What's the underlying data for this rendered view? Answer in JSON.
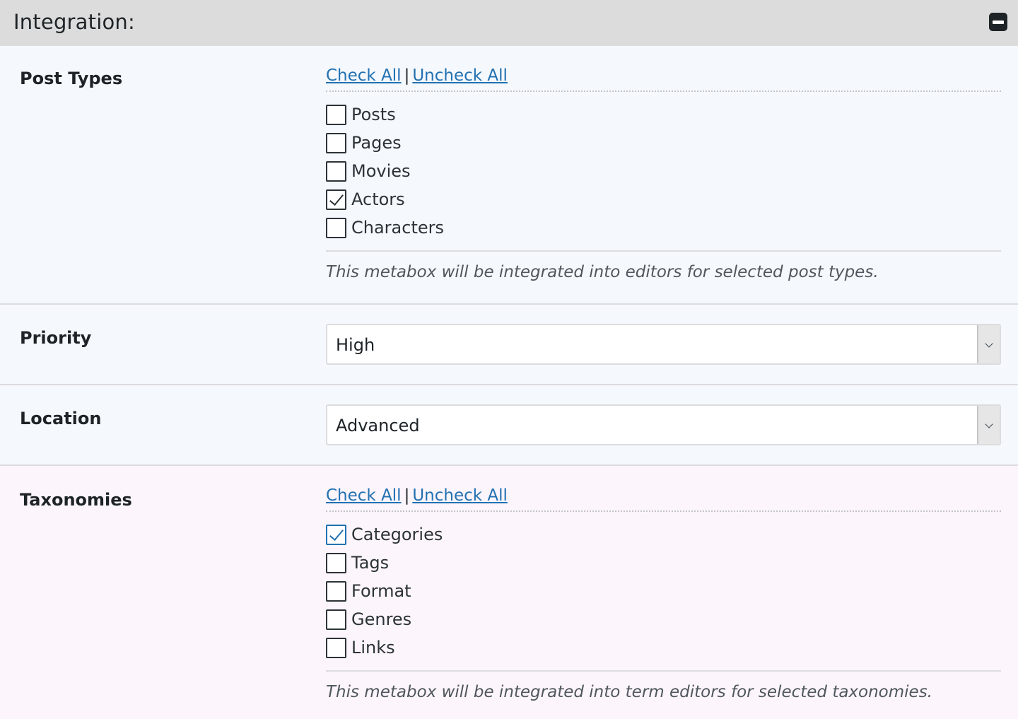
{
  "header": {
    "title": "Integration:"
  },
  "post_types": {
    "label": "Post Types",
    "check_all": "Check All",
    "separator": "|",
    "uncheck_all": "Uncheck All",
    "items": [
      {
        "label": "Posts",
        "checked": false
      },
      {
        "label": "Pages",
        "checked": false
      },
      {
        "label": "Movies",
        "checked": false
      },
      {
        "label": "Actors",
        "checked": true
      },
      {
        "label": "Characters",
        "checked": false
      }
    ],
    "description": "This metabox will be integrated into editors for selected post types."
  },
  "priority": {
    "label": "Priority",
    "value": "High"
  },
  "location": {
    "label": "Location",
    "value": "Advanced"
  },
  "taxonomies": {
    "label": "Taxonomies",
    "check_all": "Check All",
    "separator": "|",
    "uncheck_all": "Uncheck All",
    "items": [
      {
        "label": "Categories",
        "checked": true
      },
      {
        "label": "Tags",
        "checked": false
      },
      {
        "label": "Format",
        "checked": false
      },
      {
        "label": "Genres",
        "checked": false
      },
      {
        "label": "Links",
        "checked": false
      }
    ],
    "description": "This metabox will be integrated into term editors for selected taxonomies."
  },
  "colors": {
    "header_bg": "#dcdcdc",
    "link": "#2271b1",
    "section_bg": "#f5f8fc",
    "taxonomies_bg": "#fcf5fb"
  }
}
